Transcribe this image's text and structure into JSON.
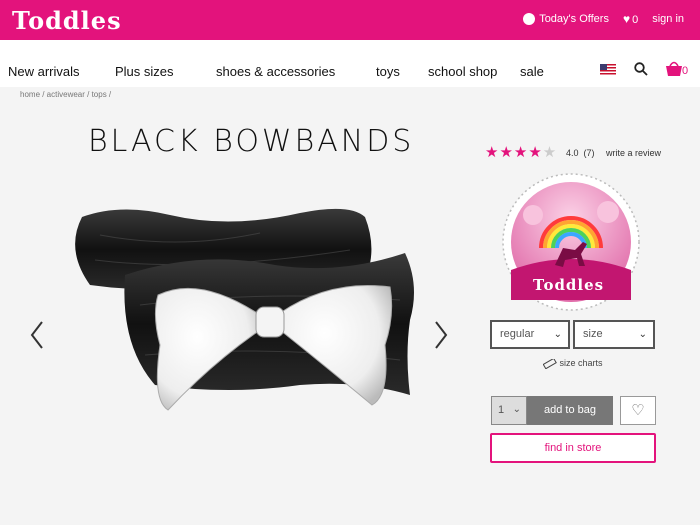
{
  "header": {
    "logo": "Toddles",
    "offers_label": "Today's Offers",
    "wishlist_count": "0",
    "sign_in_label": "sign in"
  },
  "nav": {
    "items": [
      "New arrivals",
      "Plus sizes",
      "shoes & accessories",
      "toys",
      "school shop",
      "sale"
    ],
    "cart_count": "0"
  },
  "breadcrumb": "home / activewear / tops /",
  "product": {
    "title": "BLACK BOWBANDS",
    "rating": 4.0,
    "rating_text": "4.0",
    "review_count": "(7)",
    "write_review_label": "write a review",
    "badge_text": "Toddles",
    "regular_label": "regular",
    "size_label": "size",
    "size_charts_label": "size charts",
    "qty_value": "1",
    "add_to_bag_label": "add to bag",
    "find_in_store_label": "find in store"
  },
  "colors": {
    "brand_pink": "#e3137c",
    "add_button": "#777777"
  },
  "icons": [
    "dollar-coin-icon",
    "heart-icon",
    "us-flag-icon",
    "search-icon",
    "cart-icon",
    "chevron-left-icon",
    "chevron-right-icon",
    "chevron-down-icon",
    "ruler-icon",
    "wishlist-heart-icon"
  ]
}
